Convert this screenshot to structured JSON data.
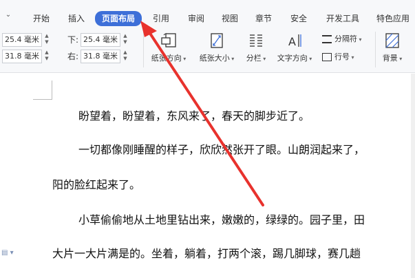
{
  "menu": {
    "tabs": [
      "开始",
      "插入",
      "页面布局",
      "引用",
      "审阅",
      "视图",
      "章节",
      "安全",
      "开发工具",
      "特色应用"
    ],
    "active_tab": "页面布局"
  },
  "margins": {
    "top_value": "25.4 毫米",
    "bottom_label": "下:",
    "bottom_value": "25.4 毫米",
    "left_value": "31.8 毫米",
    "right_label": "右:",
    "right_value": "31.8 毫米"
  },
  "tools": {
    "orientation": "纸张方向",
    "size": "纸张大小",
    "columns": "分栏",
    "text_direction": "文字方向",
    "separator": "分隔符",
    "line_number": "行号",
    "background": "背景"
  },
  "document": {
    "paragraphs": [
      "盼望着，盼望着，东风来了，春天的脚步近了。",
      "一切都像刚睡醒的样子，欣欣然张开了眼。山朗润起来了，",
      "阳的脸红起来了。",
      "小草偷偷地从土地里钻出来，嫩嫩的，绿绿的。园子里，田",
      "大片一大片满是的。坐着，躺着，打两个滚，踢几脚球，赛几趟"
    ]
  },
  "colors": {
    "active_tab_bg": "#3d6fd8",
    "arrow": "#e8322d"
  }
}
